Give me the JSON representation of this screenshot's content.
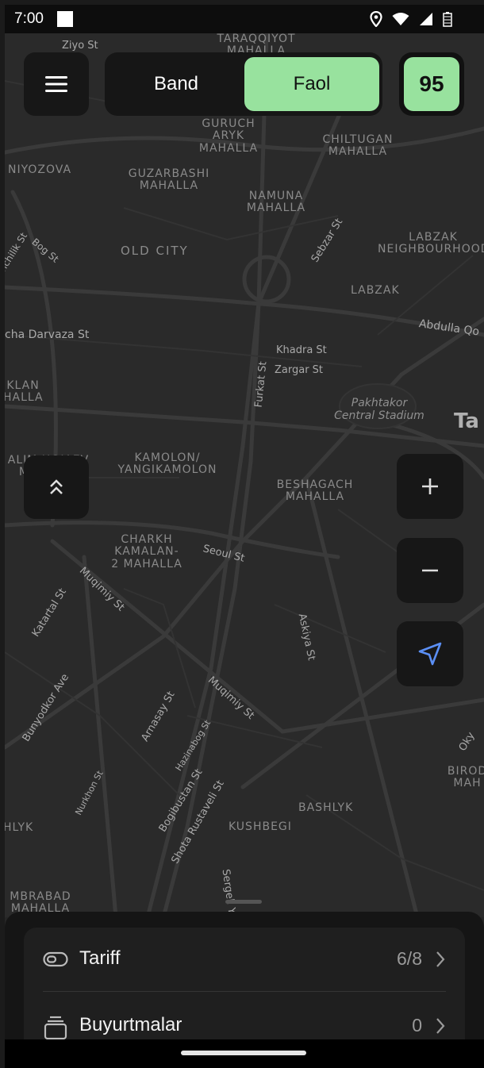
{
  "status_bar": {
    "time": "7:00"
  },
  "top_bar": {
    "toggle": {
      "off_label": "Band",
      "on_label": "Faol",
      "selected": "Faol"
    },
    "score": "95"
  },
  "map": {
    "area_labels": [
      "TARAQQIYOT MAHALLA",
      "GURUCH ARYK MAHALLA",
      "CHILTUGAN MAHALLA",
      "NIYOZOVA",
      "GUZARBASHI MAHALLA",
      "NAMUNA MAHALLA",
      "OLD CITY",
      "LABZAK NEIGHBOURHOOD",
      "LABZAK",
      "KAMOLON/ YANGIKAMOLON",
      "BESHAGACH MAHALLA",
      "CHARKH KAMALAN- 2 MAHALLA",
      "BASHLYK",
      "KUSHBEGI",
      "MBRABAD MAHALLA",
      "BIROD MAH",
      "ALIM HOJAEV MAHALLA",
      "KLAN HALLA",
      "HLYK"
    ],
    "place_labels": [
      "Pakhtakor Central Stadium",
      "Ta"
    ],
    "street_labels": [
      "Ziyo St",
      "Sebzar St",
      "Abdulla Qo",
      "cha Darvaza St",
      "Khadra St",
      "Zargar St",
      "Furkat St",
      "Seoul St",
      "Muqimiy St",
      "Katartal St",
      "Bunyodkor Ave",
      "Arnasay St",
      "Muqimiy St",
      "Askiya St",
      "Hazinabog St",
      "Nurkhon St",
      "Bogibustan St",
      "Shota Rustaveli St",
      "Sergeli Yo",
      "Bog St",
      "nchilik St",
      "Oky"
    ]
  },
  "icons": {
    "menu": "menu-icon",
    "expand": "chevron-double-up-icon",
    "zoom_in": "plus-icon",
    "zoom_out": "minus-icon",
    "locate": "navigation-arrow-icon",
    "tariff": "toggle-icon",
    "orders": "stack-icon",
    "chevron": "chevron-right-icon"
  },
  "colors": {
    "accent": "#98e29e",
    "locate": "#5b8ff5"
  },
  "bottom_sheet": {
    "rows": [
      {
        "label": "Tariff",
        "value": "6/8"
      },
      {
        "label": "Buyurtmalar",
        "value": "0"
      }
    ]
  }
}
